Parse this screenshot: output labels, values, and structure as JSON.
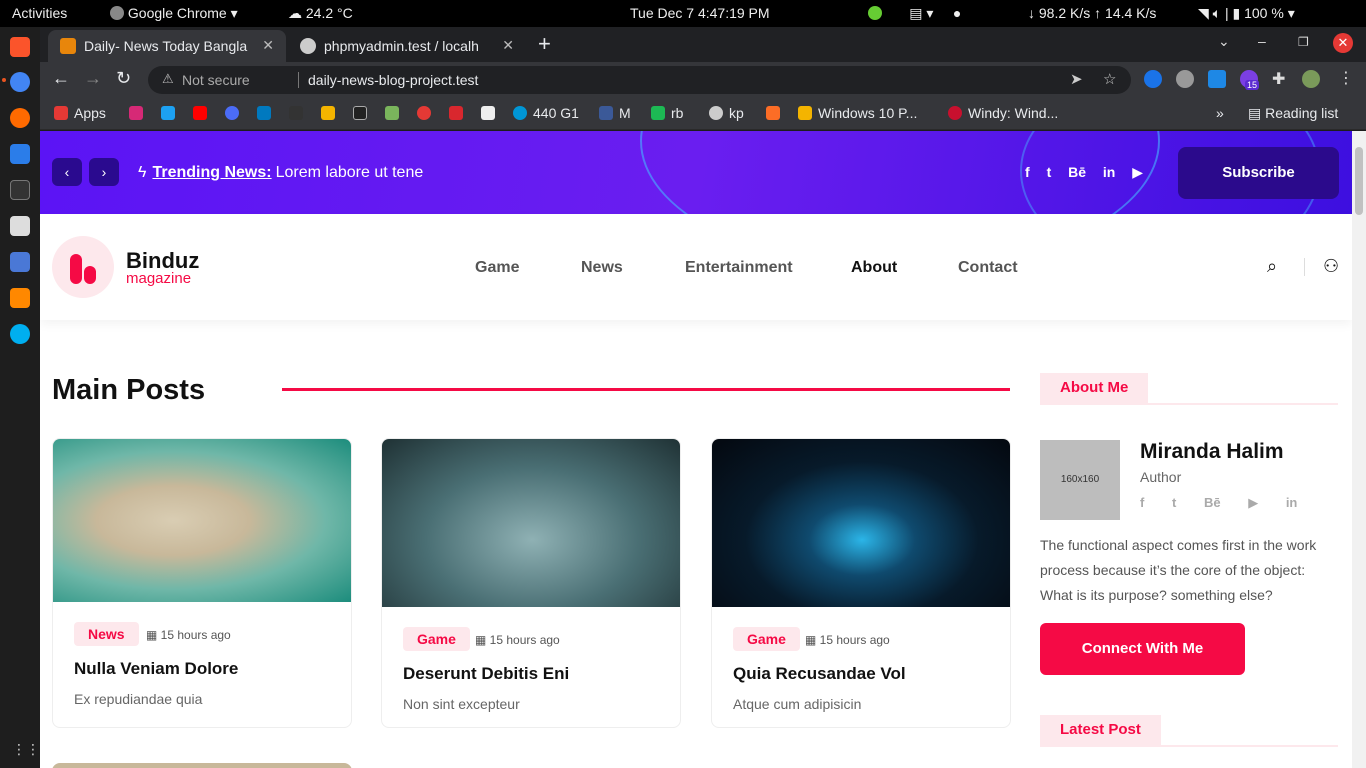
{
  "system_bar": {
    "activities": "Activities",
    "app_name": "Google Chrome",
    "weather": "24.2 °C",
    "datetime": "Tue Dec 7   4:47:19 PM",
    "network": "↓ 98.2 K/s ↑ 14.4 K/s",
    "battery": "100 %"
  },
  "browser": {
    "tabs": [
      {
        "title": "Daily- News Today Bangla",
        "active": true
      },
      {
        "title": "phpmyadmin.test / localh",
        "active": false
      }
    ],
    "omnibox": {
      "security": "Not secure",
      "url": "daily-news-blog-project.test"
    },
    "bookmarks": [
      {
        "label": "Apps"
      },
      {
        "label": "440 G1"
      },
      {
        "label": "M"
      },
      {
        "label": "rb"
      },
      {
        "label": "kp"
      },
      {
        "label": "Windows 10 P..."
      },
      {
        "label": "Windy: Wind..."
      }
    ],
    "reading_list": "Reading list",
    "extension_badge": "15"
  },
  "page": {
    "topbar": {
      "trending_label": "Trending News:",
      "trending_text": "Lorem labore ut tene",
      "social_icons": [
        "f",
        "t",
        "Bē",
        "in",
        "▶"
      ],
      "subscribe_label": "Subscribe"
    },
    "header": {
      "brand": "Binduz",
      "brand_sub": "magazine",
      "menu": [
        "Game",
        "News",
        "Entertainment",
        "About",
        "Contact"
      ],
      "current_menu": "About"
    },
    "main": {
      "section_title": "Main Posts",
      "posts": [
        {
          "tag": "News",
          "time": "15 hours ago",
          "title": "Nulla Veniam Dolore",
          "excerpt": "Ex repudiandae quia"
        },
        {
          "tag": "Game",
          "time": "15 hours ago",
          "title": "Deserunt Debitis Eni",
          "excerpt": "Non sint excepteur"
        },
        {
          "tag": "Game",
          "time": "15 hours ago",
          "title": "Quia Recusandae Vol",
          "excerpt": "Atque cum adipisicin"
        }
      ]
    },
    "sidebar": {
      "about_heading": "About Me",
      "avatar_placeholder": "160x160",
      "author_name": "Miranda Halim",
      "author_role": "Author",
      "author_socials": [
        "f",
        "t",
        "Bē",
        "▶",
        "in"
      ],
      "about_text": "The functional aspect comes first in the work process because it’s the core of the object: What is its purpose? something else?",
      "connect_label": "Connect With Me",
      "latest_heading": "Latest Post"
    }
  },
  "colors": {
    "accent": "#f50a45",
    "hero_purple": "#5b14f5",
    "hero_dark": "#2b0a8c"
  }
}
